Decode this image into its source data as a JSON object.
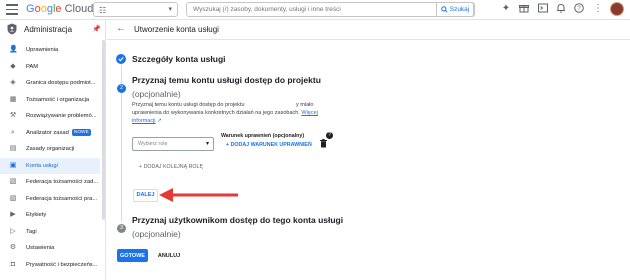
{
  "topbar": {
    "logo": {
      "g": "G",
      "o1": "o",
      "o2": "o",
      "g2": "g",
      "l": "l",
      "e": "e",
      "cloud": " Cloud"
    },
    "search_placeholder": "Wyszukaj (/) zasoby, dokumenty, usługi i inne treści",
    "search_button": "Szukaj",
    "icons": [
      "gemini-icon",
      "gift-icon",
      "cloud-shell-icon",
      "notifications-icon",
      "help-icon",
      "more-icon"
    ]
  },
  "sidebar": {
    "title": "Administracja",
    "items": [
      {
        "label": "Uprawnienia",
        "icon": "person-add-icon"
      },
      {
        "label": "PAM",
        "icon": "shield-key-icon"
      },
      {
        "label": "Granica dostępu podmiot...",
        "icon": "shield-icon"
      },
      {
        "label": "Tożsamość i organizacja",
        "icon": "org-icon"
      },
      {
        "label": "Rozwiązywanie problemó...",
        "icon": "wrench-icon"
      },
      {
        "label": "Analizator zasad",
        "icon": "magnify-icon",
        "badge": "NOWE"
      },
      {
        "label": "Zasady organizacji",
        "icon": "doc-icon"
      },
      {
        "label": "Konta usługi",
        "icon": "service-account-icon",
        "active": true
      },
      {
        "label": "Federacja tożsamości zad...",
        "icon": "federation-icon"
      },
      {
        "label": "Federacja tożsamości pra...",
        "icon": "federation-icon"
      },
      {
        "label": "Etykiety",
        "icon": "tag-icon"
      },
      {
        "label": "Tagi",
        "icon": "tags-icon"
      },
      {
        "label": "Ustawienia",
        "icon": "gear-icon"
      },
      {
        "label": "Prywatność i bezpieczeńs...",
        "icon": "lock-icon"
      }
    ]
  },
  "page": {
    "title": "Utworzenie konta usługi",
    "step1_title": "Szczegóły konta usługi",
    "step2_title": "Przyznaj temu kontu usługi dostęp do projektu",
    "step2_sub": "(opcjonalnie)",
    "step2_desc_a": "Przyznaj temu kontu usługi dostęp do projektu",
    "step2_desc_b": "y miało uprawnienia do wykonywania konkretnych działań na jego zasobach.",
    "step2_desc_link": "Więcej informacji",
    "role_placeholder": "Wybierz rolę",
    "condition_label": "Warunek uprawnień (opcjonalny)",
    "add_condition": "+ DODAJ WARUNEK UPRAWNIEŃ",
    "add_role": "+ DODAJ KOLEJNĄ ROLĘ",
    "next_button": "DALEJ",
    "step2_number": "2",
    "step3_number": "3",
    "step3_title": "Przyznaj użytkownikom dostęp do tego konta usługi",
    "step3_sub": "(opcjonalnie)",
    "done_button": "GOTOWE",
    "cancel_button": "ANULUJ"
  },
  "colors": {
    "accent": "#1a73e8",
    "arrow": "#e53935"
  }
}
